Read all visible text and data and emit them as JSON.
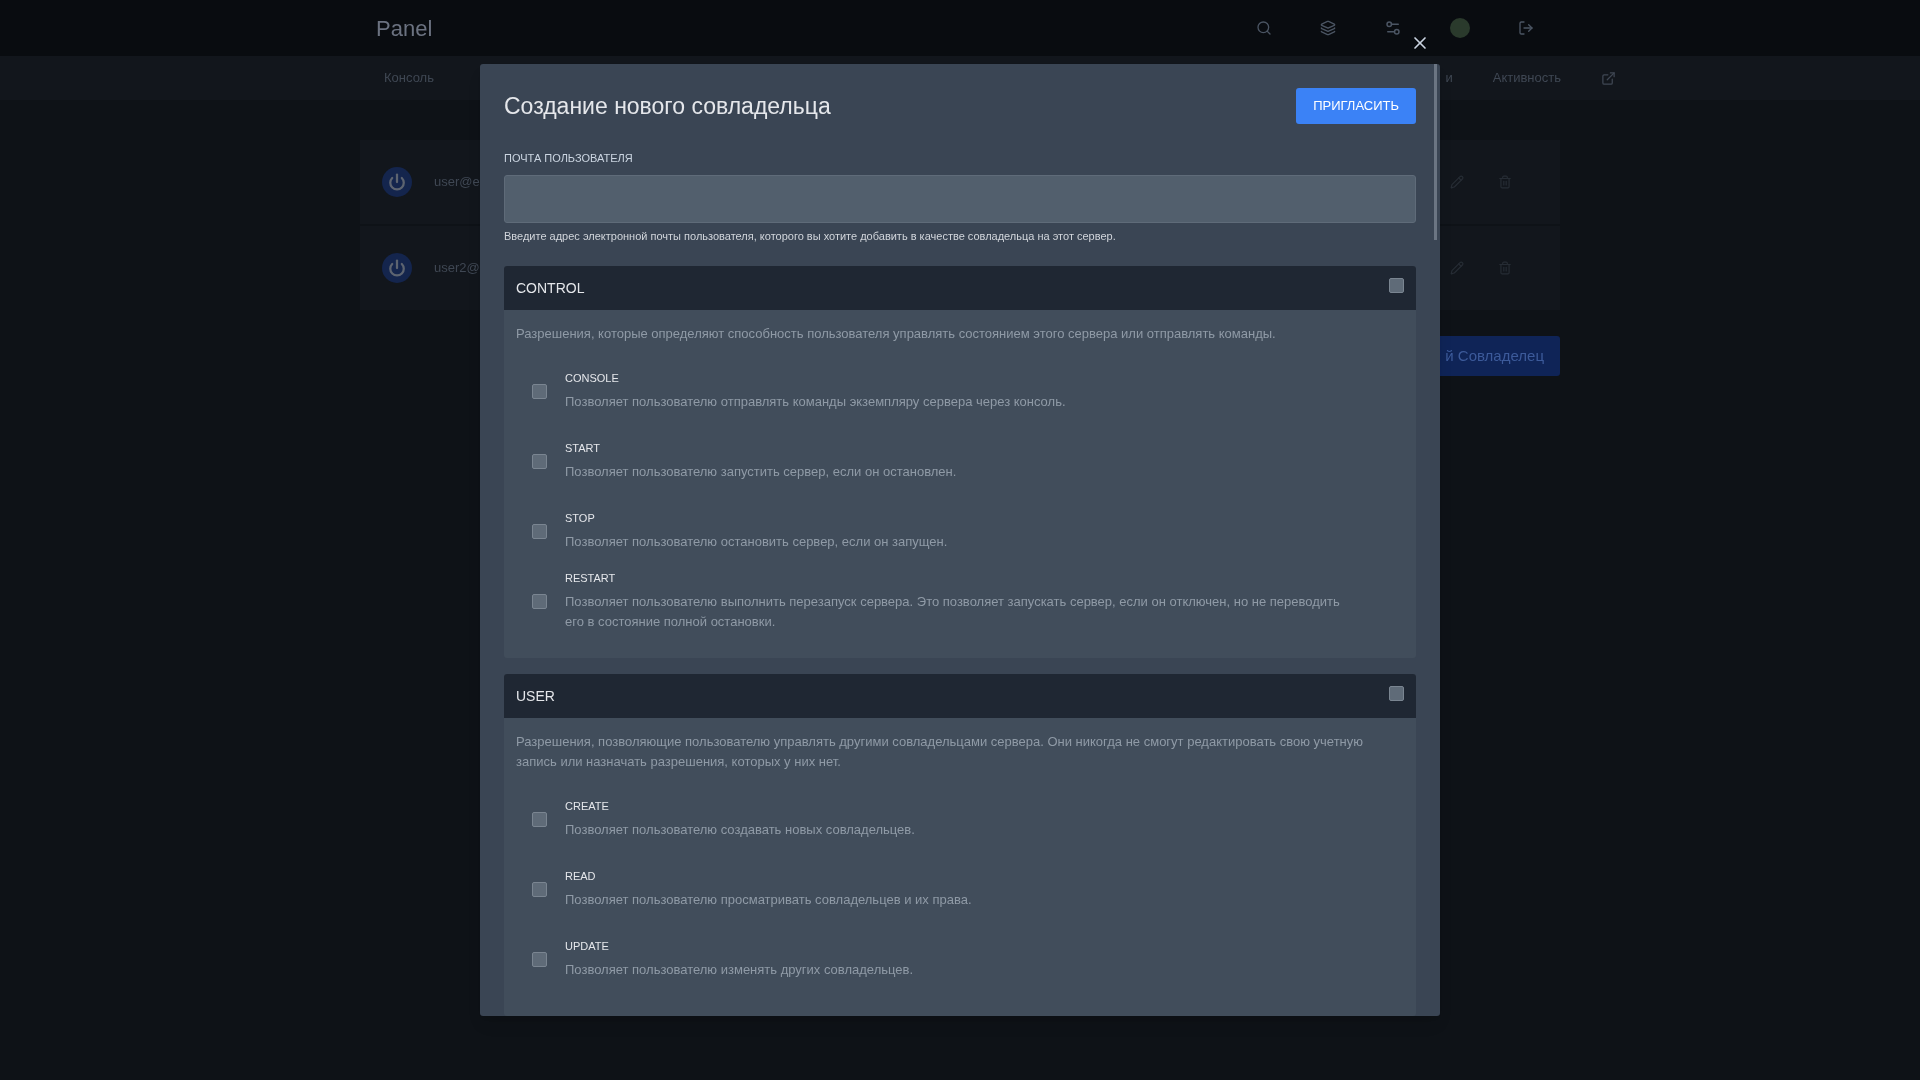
{
  "topbar": {
    "brand": "Panel"
  },
  "subnav": {
    "tabs": [
      {
        "label": "Консоль",
        "selected": false
      },
      {
        "label": "и",
        "selected": false
      },
      {
        "label": "Активность",
        "selected": false
      }
    ]
  },
  "subusers": [
    {
      "email": "user@e"
    },
    {
      "email": "user2@"
    }
  ],
  "add_button": "й Совладелец",
  "modal": {
    "title": "Создание нового совладельца",
    "invite_button": "ПРИГЛАСИТЬ",
    "email_field": {
      "label": "ПОЧТА ПОЛЬЗОВАТЕЛЯ",
      "help": "Введите адрес электронной почты пользователя, которого вы хотите добавить в качестве совладельца на этот сервер."
    },
    "groups": [
      {
        "name": "CONTROL",
        "checked": false,
        "description": "Разрешения, которые определяют способность пользователя управлять состоянием этого сервера или отправлять команды.",
        "permissions": [
          {
            "name": "CONSOLE",
            "checked": false,
            "description": "Позволяет пользователю отправлять команды экземпляру сервера через консоль."
          },
          {
            "name": "START",
            "checked": false,
            "description": "Позволяет пользователю запустить сервер, если он остановлен."
          },
          {
            "name": "STOP",
            "checked": false,
            "description": "Позволяет пользователю остановить сервер, если он запущен."
          },
          {
            "name": "RESTART",
            "checked": false,
            "description": "Позволяет пользователю выполнить перезапуск сервера. Это позволяет запускать сервер, если он отключен, но не переводить его в состояние полной остановки."
          }
        ]
      },
      {
        "name": "USER",
        "checked": false,
        "description": "Разрешения, позволяющие пользователю управлять другими совладельцами сервера. Они никогда не смогут редактировать свою учетную запись или назначать разрешения, которых у них нет.",
        "permissions": [
          {
            "name": "CREATE",
            "checked": false,
            "description": "Позволяет пользователю создавать новых совладельцев."
          },
          {
            "name": "READ",
            "checked": false,
            "description": "Позволяет пользователю просматривать совладельцев и их права."
          },
          {
            "name": "UPDATE",
            "checked": false,
            "description": "Позволяет пользователю изменять других совладельцев."
          }
        ]
      }
    ]
  }
}
